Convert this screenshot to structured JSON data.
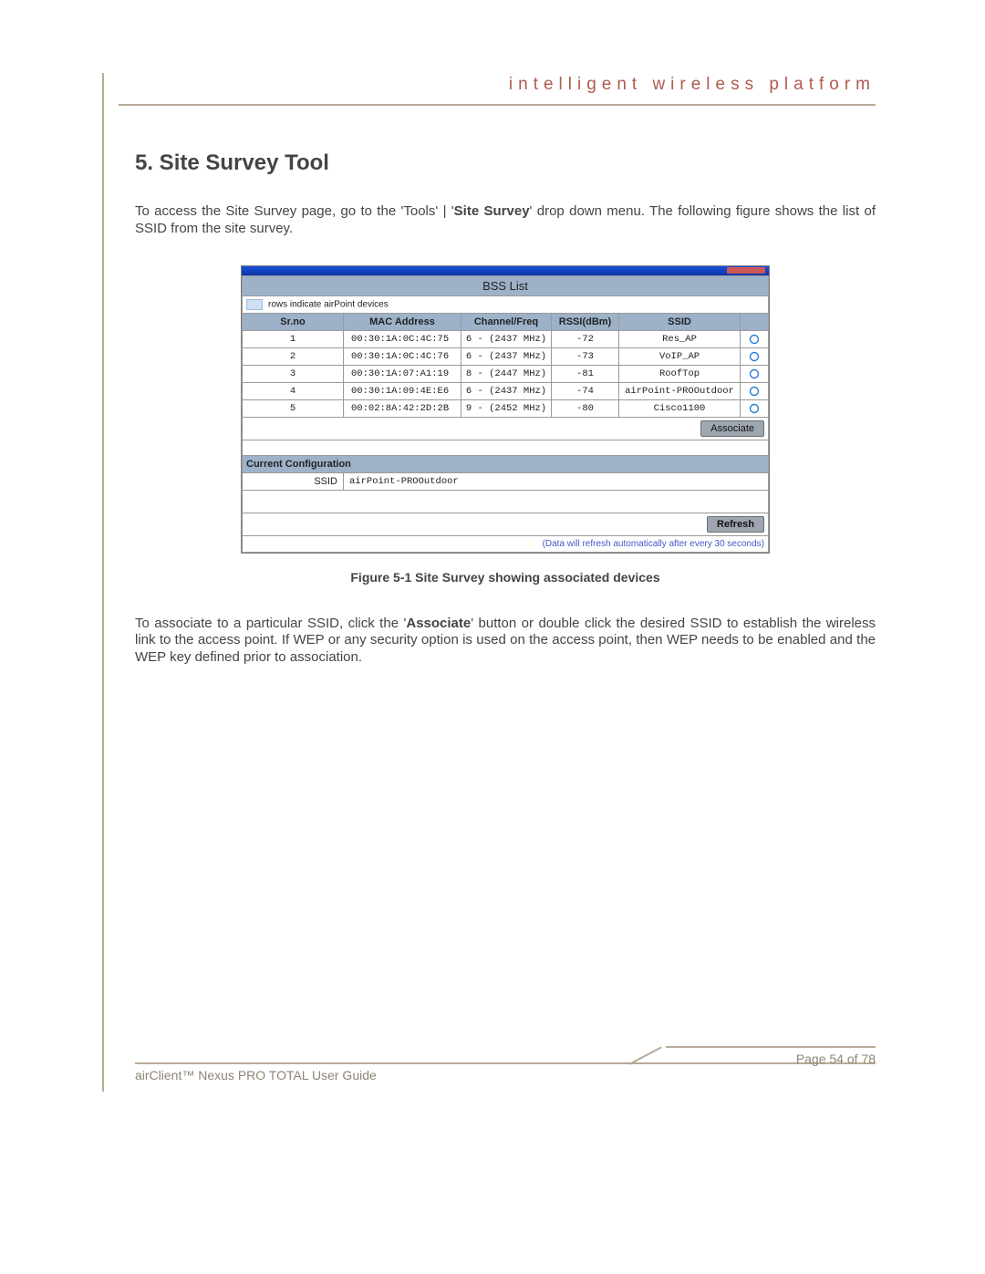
{
  "header": {
    "tagline": "intelligent   wireless   platform"
  },
  "section": {
    "title": "5. Site Survey Tool",
    "intro_a": "To access the Site Survey page, go to the 'Tools' | '",
    "intro_bold": "Site Survey",
    "intro_b": "' drop down menu. The following figure shows the list of SSID from the site survey."
  },
  "bss_list": {
    "panel_title": "BSS List",
    "legend_text": "rows indicate airPoint devices",
    "columns": {
      "srno": "Sr.no",
      "mac": "MAC Address",
      "chan": "Channel/Freq",
      "rssi": "RSSI(dBm)",
      "ssid": "SSID"
    },
    "rows": [
      {
        "srno": "1",
        "mac": "00:30:1A:0C:4C:75",
        "chan": "6 - (2437 MHz)",
        "rssi": "-72",
        "ssid": "Res_AP"
      },
      {
        "srno": "2",
        "mac": "00:30:1A:0C:4C:76",
        "chan": "6 - (2437 MHz)",
        "rssi": "-73",
        "ssid": "VoIP_AP"
      },
      {
        "srno": "3",
        "mac": "00:30:1A:07:A1:19",
        "chan": "8 - (2447 MHz)",
        "rssi": "-81",
        "ssid": "RoofTop"
      },
      {
        "srno": "4",
        "mac": "00:30:1A:09:4E:E6",
        "chan": "6 - (2437 MHz)",
        "rssi": "-74",
        "ssid": "airPoint-PROOutdoor"
      },
      {
        "srno": "5",
        "mac": "00:02:8A:42:2D:2B",
        "chan": "9 - (2452 MHz)",
        "rssi": "-80",
        "ssid": "Cisco1100"
      }
    ],
    "associate_btn": "Associate",
    "current_config_header": "Current Configuration",
    "current_ssid_label": "SSID",
    "current_ssid_value": "airPoint-PROOutdoor",
    "refresh_btn": "Refresh",
    "refresh_note": "(Data will refresh automatically after every 30 seconds)"
  },
  "figure_caption": "Figure 5-1 Site Survey showing associated devices",
  "para2": {
    "a": "To associate to a particular SSID, click the '",
    "b_bold": "Associate",
    "c": "' button or double click the desired SSID to establish the wireless link to the access point. If WEP or any security option is used on the access point, then WEP needs to be enabled and the WEP key defined prior to association."
  },
  "footer": {
    "guide": "airClient™ Nexus PRO TOTAL User Guide",
    "page": "Page 54 of 78"
  }
}
